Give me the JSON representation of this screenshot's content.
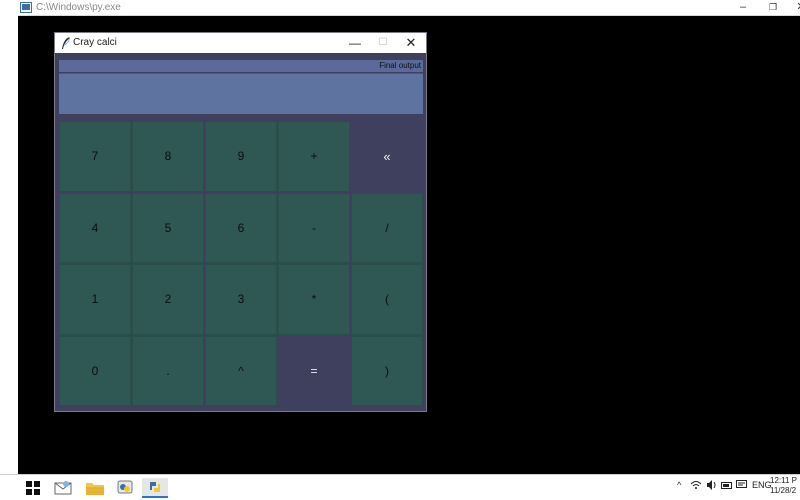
{
  "console_window": {
    "title": "C:\\Windows\\py.exe",
    "min_label": "–",
    "max_label": "❐",
    "close_label": "✕"
  },
  "app_window": {
    "title": "Cray calci",
    "min_label": "—",
    "max_label": "☐",
    "close_label": "✕",
    "output_label": "Final output",
    "display_value": ""
  },
  "keypad": {
    "rows": [
      [
        "7",
        "8",
        "9",
        "+",
        "«"
      ],
      [
        "4",
        "5",
        "6",
        "-",
        "/"
      ],
      [
        "1",
        "2",
        "3",
        "*",
        "("
      ],
      [
        "0",
        ".",
        "^",
        "=",
        ")"
      ]
    ]
  },
  "taskbar": {
    "tray_items": [
      "^",
      "ENG"
    ],
    "time": "12:11 P",
    "date": "11/28/2"
  },
  "colors": {
    "key_bg": "#2f5753",
    "special_key_bg": "#3f3f5e",
    "display_bg": "#5e73a0",
    "window_bg": "#3f3f5e"
  }
}
